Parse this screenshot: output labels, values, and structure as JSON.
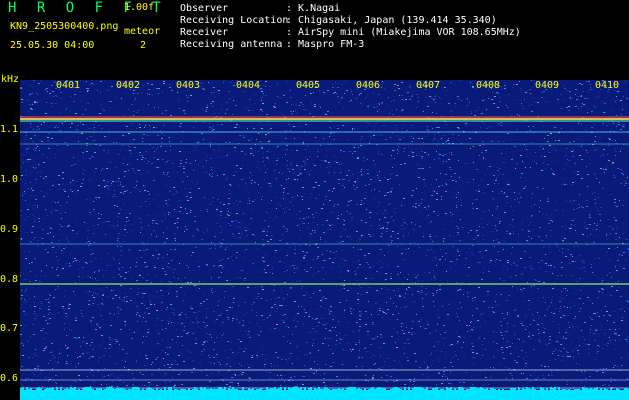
{
  "header": {
    "logo": "H R O F F T",
    "version": "1.00f",
    "filename": "KN9_2505300400.png",
    "meteor_label": "meteor",
    "datetime": "25.05.30 04:00",
    "count": "2"
  },
  "info": [
    {
      "label": "Observer",
      "value": ": K.Nagai"
    },
    {
      "label": "Receiving Location",
      "value": ": Chigasaki, Japan (139.414 35.340)"
    },
    {
      "label": "Receiver",
      "value": ": AirSpy mini (Miakejima VOR 108.65MHz)"
    },
    {
      "label": "Receiving antenna",
      "value": ": Maspro FM-3"
    }
  ],
  "axis": {
    "unit": "kHz",
    "y_ticks": [
      "1.1",
      "1.0",
      "0.9",
      "0.8",
      "0.7",
      "0.6"
    ],
    "x_ticks": [
      "0401",
      "0402",
      "0403",
      "0404",
      "0405",
      "0406",
      "0407",
      "0408",
      "0409",
      "0410"
    ]
  },
  "colors": {
    "background": "#000000",
    "plot_base": "#0a1a78",
    "axis_text": "#ffff00",
    "logo": "#00ff66",
    "info_text": "#ffffff",
    "baseline": "#00e5ff"
  }
}
